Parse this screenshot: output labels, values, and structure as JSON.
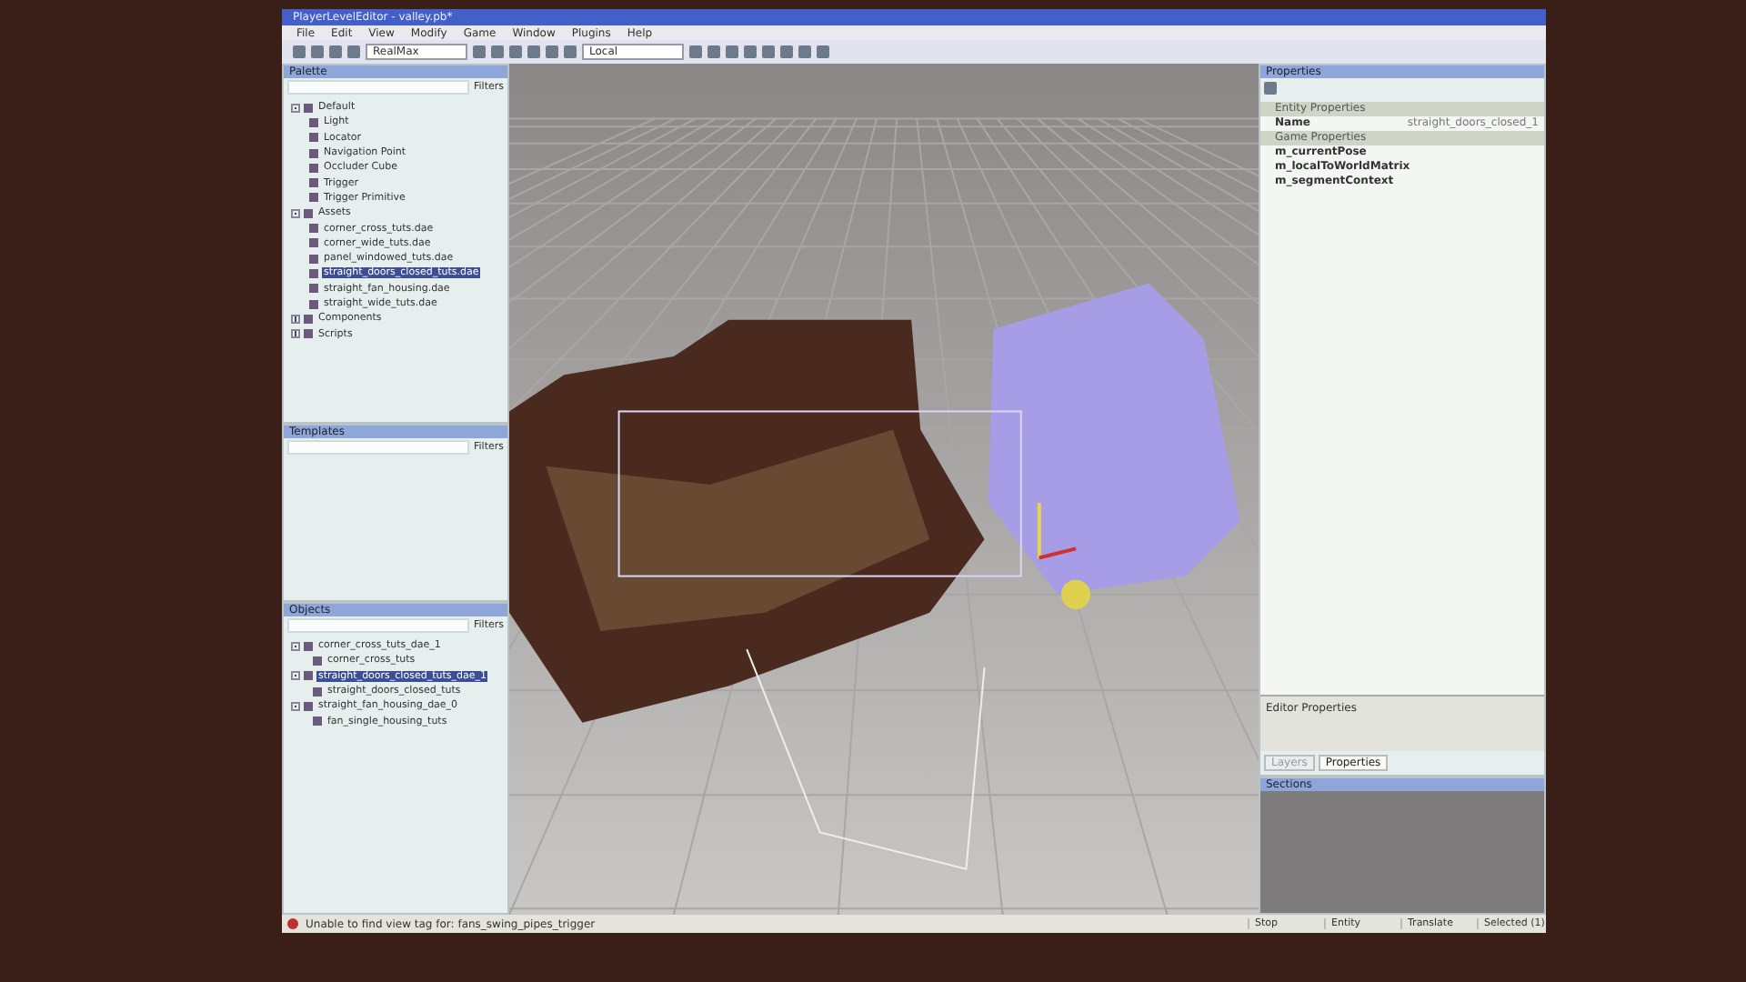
{
  "window": {
    "title": "PlayerLevelEditor - valley.pb*"
  },
  "menu": [
    "File",
    "Edit",
    "View",
    "Modify",
    "Game",
    "Window",
    "Plugins",
    "Help"
  ],
  "toolbar": {
    "combo_1": "RealMax",
    "combo_2": "Local"
  },
  "palette": {
    "title": "Palette",
    "filter": "Filters",
    "items": [
      {
        "label": "Default",
        "expanded": true,
        "selected": false,
        "children": [
          {
            "label": "Light",
            "selected": false
          },
          {
            "label": "Locator",
            "selected": false
          },
          {
            "label": "Navigation Point",
            "selected": false
          },
          {
            "label": "Occluder Cube",
            "selected": false
          },
          {
            "label": "Trigger",
            "selected": false
          },
          {
            "label": "Trigger Primitive",
            "selected": false
          }
        ]
      },
      {
        "label": "Assets",
        "expanded": true,
        "selected": false,
        "children": [
          {
            "label": "corner_cross_tuts.dae",
            "selected": false
          },
          {
            "label": "corner_wide_tuts.dae",
            "selected": false
          },
          {
            "label": "panel_windowed_tuts.dae",
            "selected": false
          },
          {
            "label": "straight_doors_closed_tuts.dae",
            "selected": true
          },
          {
            "label": "straight_fan_housing.dae",
            "selected": false
          },
          {
            "label": "straight_wide_tuts.dae",
            "selected": false
          }
        ]
      },
      {
        "label": "Components",
        "expanded": false,
        "selected": false
      },
      {
        "label": "Scripts",
        "expanded": false,
        "selected": false
      }
    ]
  },
  "templates": {
    "title": "Templates",
    "filter": "Filters"
  },
  "objects": {
    "title": "Objects",
    "filter": "Filters",
    "items": [
      {
        "label": "corner_cross_tuts_dae_1",
        "expanded": true,
        "selected": false,
        "children": [
          {
            "label": "corner_cross_tuts",
            "selected": false
          }
        ]
      },
      {
        "label": "straight_doors_closed_tuts_dae_1",
        "expanded": true,
        "selected": true,
        "children": [
          {
            "label": "straight_doors_closed_tuts",
            "selected": false
          }
        ]
      },
      {
        "label": "straight_fan_housing_dae_0",
        "expanded": true,
        "selected": false,
        "children": [
          {
            "label": "fan_single_housing_tuts",
            "selected": false
          }
        ]
      }
    ]
  },
  "properties": {
    "title": "Properties",
    "groups": [
      {
        "label": "Entity Properties",
        "rows": [
          {
            "name": "Name",
            "value": "straight_doors_closed_1"
          }
        ]
      },
      {
        "label": "Game Properties",
        "rows": [
          {
            "name": "m_currentPose",
            "value": ""
          },
          {
            "name": "m_localToWorldMatrix",
            "value": ""
          },
          {
            "name": "m_segmentContext",
            "value": ""
          }
        ]
      }
    ],
    "editor_properties": "Editor Properties",
    "tabs": [
      {
        "label": "Layers",
        "selected": false
      },
      {
        "label": "Properties",
        "selected": true
      }
    ]
  },
  "sections": {
    "title": "Sections"
  },
  "status_bar": {
    "message": "Unable to find view tag for: fans_swing_pipes_trigger",
    "fields": [
      "Stop",
      "Entity",
      "Translate",
      "Selected (1)"
    ]
  }
}
